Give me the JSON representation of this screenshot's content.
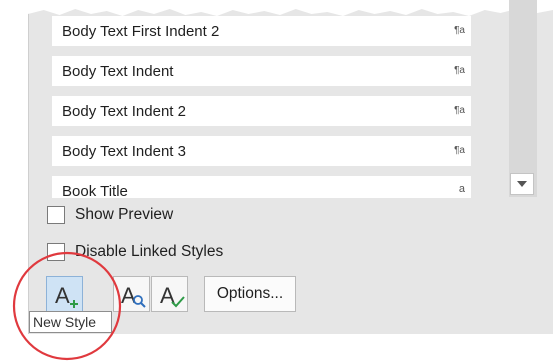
{
  "styles_list": {
    "items": [
      {
        "name": "Body Text First Indent 2",
        "kind": "¶a"
      },
      {
        "name": "Body Text Indent",
        "kind": "¶a"
      },
      {
        "name": "Body Text Indent 2",
        "kind": "¶a"
      },
      {
        "name": "Body Text Indent 3",
        "kind": "¶a"
      },
      {
        "name": "Book Title",
        "kind": "a"
      }
    ]
  },
  "options": {
    "show_preview": {
      "label": "Show Preview",
      "checked": false
    },
    "disable_linked_styles": {
      "label": "Disable Linked Styles",
      "checked": false
    }
  },
  "toolbar": {
    "new_style_icon": "new-style-icon",
    "style_inspector_icon": "style-inspector-icon",
    "manage_styles_icon": "manage-styles-icon",
    "options_label": "Options..."
  },
  "tooltip": {
    "text": "New Style"
  },
  "colors": {
    "annotation_circle": "#e0393e",
    "accent_green": "#2e9b47",
    "accent_blue": "#2f6fbd",
    "selected_button": "#cfe3f5"
  }
}
